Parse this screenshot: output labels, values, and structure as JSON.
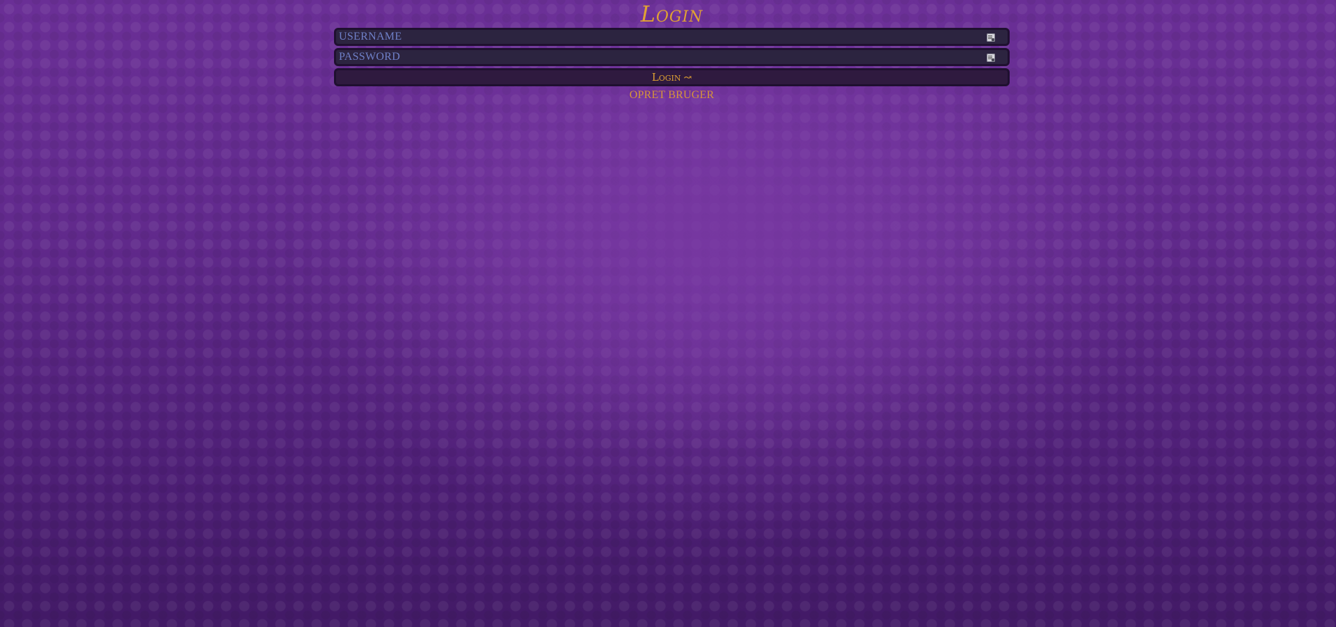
{
  "page": {
    "title": "Login"
  },
  "form": {
    "username": {
      "placeholder": "USERNAME",
      "value": "",
      "icon": "autofill-card-icon"
    },
    "password": {
      "placeholder": "PASSWORD",
      "value": "",
      "icon": "autofill-card-icon"
    },
    "login_label": "Login",
    "login_arrow": "↝",
    "signup_label": "OPRET BRUGER"
  },
  "colors": {
    "background": "#5a2585",
    "accent_gold": "#e0a233",
    "placeholder_blue": "#6f80c8",
    "field_bg": "#2c2440",
    "field_border": "#1f1030"
  }
}
